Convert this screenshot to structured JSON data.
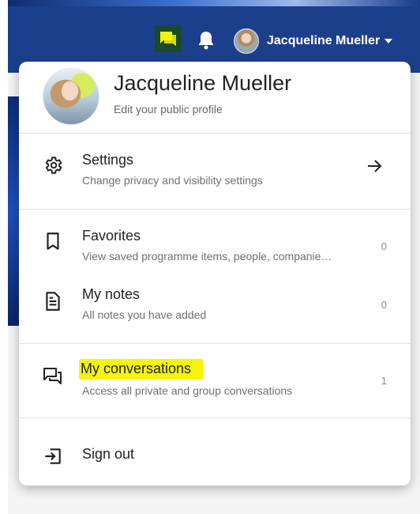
{
  "header": {
    "user_name": "Jacqueline Mueller"
  },
  "profile": {
    "name": "Jacqueline Mueller",
    "subtitle": "Edit your public profile"
  },
  "menu": {
    "settings": {
      "title": "Settings",
      "desc": "Change privacy and visibility settings"
    },
    "favorites": {
      "title": "Favorites",
      "desc": "View saved programme items, people, companie…",
      "count": "0"
    },
    "notes": {
      "title": "My notes",
      "desc": "All notes you have added",
      "count": "0"
    },
    "conversations": {
      "title": "My conversations",
      "desc": "Access all private and group conversations",
      "count": "1"
    },
    "signout": {
      "title": "Sign out"
    }
  },
  "icons": {
    "chat": "chat-icon",
    "bell": "bell-icon",
    "settings": "gear-icon",
    "favorites": "bookmark-icon",
    "notes": "document-icon",
    "conversations": "forum-icon",
    "signout": "logout-icon",
    "arrow": "arrow-right-icon"
  },
  "colors": {
    "header": "#1c3f8c",
    "highlight": "#f5f50a",
    "chat_button": "#1a4a2a"
  }
}
